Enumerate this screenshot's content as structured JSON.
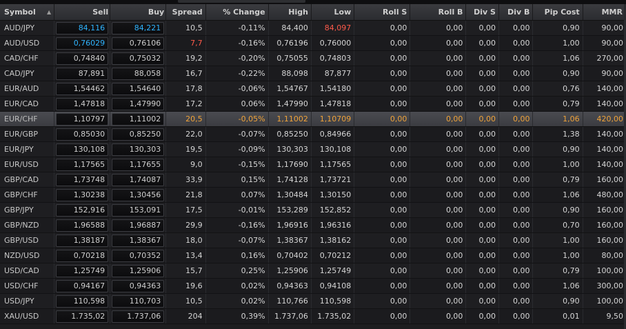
{
  "columns": {
    "symbol": "Symbol",
    "sell": "Sell",
    "buy": "Buy",
    "spread": "Spread",
    "pct_change": "% Change",
    "high": "High",
    "low": "Low",
    "roll_s": "Roll S",
    "roll_b": "Roll B",
    "div_s": "Div S",
    "div_b": "Div B",
    "pip_cost": "Pip Cost",
    "mmr": "MMR"
  },
  "sort_icon": "sort-ascending-icon",
  "colors": {
    "up": "#2fb4ff",
    "down": "#ff5a4a",
    "selected": "#f0a33a"
  },
  "selected_row": 6,
  "rows": [
    {
      "symbol": "AUD/JPY",
      "sell": "84,116",
      "buy": "84,221",
      "spread": "10,5",
      "pct": "-0,11%",
      "high": "84,400",
      "low": "84,097",
      "roll_s": "0,00",
      "roll_b": "0,00",
      "div_s": "0,00",
      "div_b": "0,00",
      "pip": "0,90",
      "mmr": "90,00",
      "sell_color": "#2fb4ff",
      "buy_color": "#2fb4ff",
      "low_color": "#ff5a4a"
    },
    {
      "symbol": "AUD/USD",
      "sell": "0,76029",
      "buy": "0,76106",
      "spread": "7,7",
      "pct": "-0,16%",
      "high": "0,76196",
      "low": "0,76000",
      "roll_s": "0,00",
      "roll_b": "0,00",
      "div_s": "0,00",
      "div_b": "0,00",
      "pip": "1,00",
      "mmr": "90,00",
      "sell_color": "#2fb4ff",
      "spread_color": "#ff5a4a"
    },
    {
      "symbol": "CAD/CHF",
      "sell": "0,74840",
      "buy": "0,75032",
      "spread": "19,2",
      "pct": "-0,20%",
      "high": "0,75055",
      "low": "0,74803",
      "roll_s": "0,00",
      "roll_b": "0,00",
      "div_s": "0,00",
      "div_b": "0,00",
      "pip": "1,06",
      "mmr": "270,00"
    },
    {
      "symbol": "CAD/JPY",
      "sell": "87,891",
      "buy": "88,058",
      "spread": "16,7",
      "pct": "-0,22%",
      "high": "88,098",
      "low": "87,877",
      "roll_s": "0,00",
      "roll_b": "0,00",
      "div_s": "0,00",
      "div_b": "0,00",
      "pip": "0,90",
      "mmr": "90,00"
    },
    {
      "symbol": "EUR/AUD",
      "sell": "1,54462",
      "buy": "1,54640",
      "spread": "17,8",
      "pct": "-0,06%",
      "high": "1,54767",
      "low": "1,54180",
      "roll_s": "0,00",
      "roll_b": "0,00",
      "div_s": "0,00",
      "div_b": "0,00",
      "pip": "0,76",
      "mmr": "140,00"
    },
    {
      "symbol": "EUR/CAD",
      "sell": "1,47818",
      "buy": "1,47990",
      "spread": "17,2",
      "pct": "0,06%",
      "high": "1,47990",
      "low": "1,47818",
      "roll_s": "0,00",
      "roll_b": "0,00",
      "div_s": "0,00",
      "div_b": "0,00",
      "pip": "0,79",
      "mmr": "140,00"
    },
    {
      "symbol": "EUR/CHF",
      "sell": "1,10797",
      "buy": "1,11002",
      "spread": "20,5",
      "pct": "-0,05%",
      "high": "1,11002",
      "low": "1,10709",
      "roll_s": "0,00",
      "roll_b": "0,00",
      "div_s": "0,00",
      "div_b": "0,00",
      "pip": "1,06",
      "mmr": "420,00"
    },
    {
      "symbol": "EUR/GBP",
      "sell": "0,85030",
      "buy": "0,85250",
      "spread": "22,0",
      "pct": "-0,07%",
      "high": "0,85250",
      "low": "0,84966",
      "roll_s": "0,00",
      "roll_b": "0,00",
      "div_s": "0,00",
      "div_b": "0,00",
      "pip": "1,38",
      "mmr": "140,00"
    },
    {
      "symbol": "EUR/JPY",
      "sell": "130,108",
      "buy": "130,303",
      "spread": "19,5",
      "pct": "-0,09%",
      "high": "130,303",
      "low": "130,108",
      "roll_s": "0,00",
      "roll_b": "0,00",
      "div_s": "0,00",
      "div_b": "0,00",
      "pip": "0,90",
      "mmr": "140,00"
    },
    {
      "symbol": "EUR/USD",
      "sell": "1,17565",
      "buy": "1,17655",
      "spread": "9,0",
      "pct": "-0,15%",
      "high": "1,17690",
      "low": "1,17565",
      "roll_s": "0,00",
      "roll_b": "0,00",
      "div_s": "0,00",
      "div_b": "0,00",
      "pip": "1,00",
      "mmr": "140,00"
    },
    {
      "symbol": "GBP/CAD",
      "sell": "1,73748",
      "buy": "1,74087",
      "spread": "33,9",
      "pct": "0,15%",
      "high": "1,74128",
      "low": "1,73721",
      "roll_s": "0,00",
      "roll_b": "0,00",
      "div_s": "0,00",
      "div_b": "0,00",
      "pip": "0,79",
      "mmr": "160,00"
    },
    {
      "symbol": "GBP/CHF",
      "sell": "1,30238",
      "buy": "1,30456",
      "spread": "21,8",
      "pct": "0,07%",
      "high": "1,30484",
      "low": "1,30150",
      "roll_s": "0,00",
      "roll_b": "0,00",
      "div_s": "0,00",
      "div_b": "0,00",
      "pip": "1,06",
      "mmr": "480,00"
    },
    {
      "symbol": "GBP/JPY",
      "sell": "152,916",
      "buy": "153,091",
      "spread": "17,5",
      "pct": "-0,01%",
      "high": "153,289",
      "low": "152,852",
      "roll_s": "0,00",
      "roll_b": "0,00",
      "div_s": "0,00",
      "div_b": "0,00",
      "pip": "0,90",
      "mmr": "160,00"
    },
    {
      "symbol": "GBP/NZD",
      "sell": "1,96588",
      "buy": "1,96887",
      "spread": "29,9",
      "pct": "-0,16%",
      "high": "1,96916",
      "low": "1,96316",
      "roll_s": "0,00",
      "roll_b": "0,00",
      "div_s": "0,00",
      "div_b": "0,00",
      "pip": "0,70",
      "mmr": "160,00"
    },
    {
      "symbol": "GBP/USD",
      "sell": "1,38187",
      "buy": "1,38367",
      "spread": "18,0",
      "pct": "-0,07%",
      "high": "1,38367",
      "low": "1,38162",
      "roll_s": "0,00",
      "roll_b": "0,00",
      "div_s": "0,00",
      "div_b": "0,00",
      "pip": "1,00",
      "mmr": "160,00"
    },
    {
      "symbol": "NZD/USD",
      "sell": "0,70218",
      "buy": "0,70352",
      "spread": "13,4",
      "pct": "0,16%",
      "high": "0,70402",
      "low": "0,70212",
      "roll_s": "0,00",
      "roll_b": "0,00",
      "div_s": "0,00",
      "div_b": "0,00",
      "pip": "1,00",
      "mmr": "80,00"
    },
    {
      "symbol": "USD/CAD",
      "sell": "1,25749",
      "buy": "1,25906",
      "spread": "15,7",
      "pct": "0,25%",
      "high": "1,25906",
      "low": "1,25749",
      "roll_s": "0,00",
      "roll_b": "0,00",
      "div_s": "0,00",
      "div_b": "0,00",
      "pip": "0,79",
      "mmr": "100,00"
    },
    {
      "symbol": "USD/CHF",
      "sell": "0,94167",
      "buy": "0,94363",
      "spread": "19,6",
      "pct": "0,02%",
      "high": "0,94363",
      "low": "0,94108",
      "roll_s": "0,00",
      "roll_b": "0,00",
      "div_s": "0,00",
      "div_b": "0,00",
      "pip": "1,06",
      "mmr": "300,00"
    },
    {
      "symbol": "USD/JPY",
      "sell": "110,598",
      "buy": "110,703",
      "spread": "10,5",
      "pct": "0,02%",
      "high": "110,766",
      "low": "110,598",
      "roll_s": "0,00",
      "roll_b": "0,00",
      "div_s": "0,00",
      "div_b": "0,00",
      "pip": "0,90",
      "mmr": "100,00"
    },
    {
      "symbol": "XAU/USD",
      "sell": "1.735,02",
      "buy": "1.737,06",
      "spread": "204",
      "pct": "0,39%",
      "high": "1.737,06",
      "low": "1.735,02",
      "roll_s": "0,00",
      "roll_b": "0,00",
      "div_s": "0,00",
      "div_b": "0,00",
      "pip": "0,01",
      "mmr": "9,50"
    }
  ]
}
